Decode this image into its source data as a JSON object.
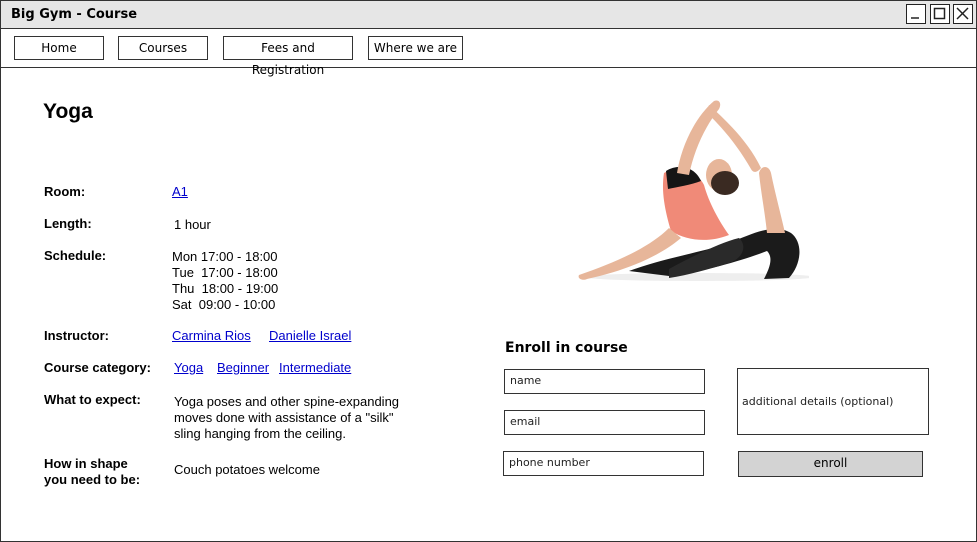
{
  "window": {
    "title": "Big Gym - Course"
  },
  "nav": {
    "items": [
      {
        "label": "Home"
      },
      {
        "label": "Courses"
      },
      {
        "label": "Fees and Registration"
      },
      {
        "label": "Where we are"
      }
    ]
  },
  "course": {
    "title": "Yoga",
    "room_label": "Room:",
    "room_value": "A1",
    "length_label": "Length:",
    "length_value": "1 hour",
    "schedule_label": "Schedule:",
    "schedule": [
      "Mon 17:00 - 18:00",
      "Tue  17:00 - 18:00",
      "Thu  18:00 - 19:00",
      "Sat  09:00 - 10:00"
    ],
    "instructor_label": "Instructor:",
    "instructors": [
      "Carmina Rios",
      "Danielle Israel"
    ],
    "category_label": "Course category:",
    "categories": [
      "Yoga",
      "Beginner",
      "Intermediate"
    ],
    "expect_label": "What to expect:",
    "expect_lines": [
      "Yoga poses and other spine-expanding",
      "moves done with assistance of a \"silk\"",
      "sling hanging from the ceiling."
    ],
    "shape_label_lines": [
      "How in shape",
      "you need to be:"
    ],
    "shape_value": "Couch potatoes welcome"
  },
  "enroll": {
    "title": "Enroll in course",
    "name_placeholder": "name",
    "email_placeholder": "email",
    "phone_placeholder": "phone number",
    "details_placeholder": "additional details (optional)",
    "submit_label": "enroll"
  },
  "icons": {
    "minimize": "minimize-icon",
    "maximize": "maximize-icon",
    "close": "close-icon",
    "photo": "yoga-pose-photo"
  }
}
